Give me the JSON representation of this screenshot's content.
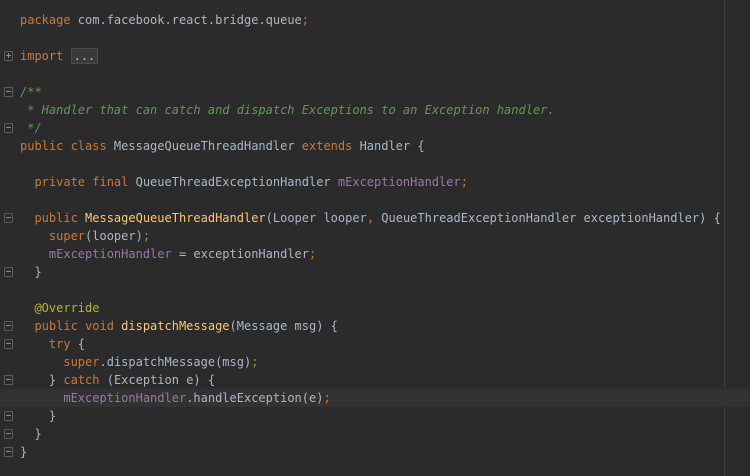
{
  "editor": {
    "lines": [
      {
        "tokens": [
          {
            "t": "package",
            "c": "kw"
          },
          {
            "t": " com.facebook.react.bridge.queue",
            "c": "pl"
          },
          {
            "t": ";",
            "c": "kw"
          }
        ]
      },
      {
        "tokens": []
      },
      {
        "fold": "plus",
        "tokens": [
          {
            "t": "import ",
            "c": "kw"
          },
          {
            "t": "...",
            "c": "collapsed"
          }
        ]
      },
      {
        "tokens": []
      },
      {
        "fold": "minus",
        "tokens": [
          {
            "t": "/**",
            "c": "cm"
          }
        ]
      },
      {
        "tokens": [
          {
            "t": " * Handler that can catch and dispatch Exceptions to an Exception handler.",
            "c": "cm"
          }
        ]
      },
      {
        "fold": "end",
        "tokens": [
          {
            "t": " */",
            "c": "cm"
          }
        ]
      },
      {
        "tokens": [
          {
            "t": "public class ",
            "c": "kw"
          },
          {
            "t": "MessageQueueThreadHandler ",
            "c": "pl"
          },
          {
            "t": "extends ",
            "c": "kw"
          },
          {
            "t": "Handler {",
            "c": "pl"
          }
        ]
      },
      {
        "tokens": []
      },
      {
        "tokens": [
          {
            "t": "  private final ",
            "c": "kw"
          },
          {
            "t": "QueueThreadExceptionHandler ",
            "c": "pl"
          },
          {
            "t": "mExceptionHandler",
            "c": "fld"
          },
          {
            "t": ";",
            "c": "kw"
          }
        ]
      },
      {
        "tokens": []
      },
      {
        "fold": "minus",
        "tokens": [
          {
            "t": "  public ",
            "c": "kw"
          },
          {
            "t": "MessageQueueThreadHandler",
            "c": "fn"
          },
          {
            "t": "(Looper looper",
            "c": "pl"
          },
          {
            "t": ", ",
            "c": "kw"
          },
          {
            "t": "QueueThreadExceptionHandler exceptionHandler) {",
            "c": "pl"
          }
        ]
      },
      {
        "tokens": [
          {
            "t": "    super",
            "c": "kw"
          },
          {
            "t": "(looper)",
            "c": "pl"
          },
          {
            "t": ";",
            "c": "kw"
          }
        ]
      },
      {
        "tokens": [
          {
            "t": "    ",
            "c": "pl"
          },
          {
            "t": "mExceptionHandler",
            "c": "fld"
          },
          {
            "t": " = exceptionHandler",
            "c": "pl"
          },
          {
            "t": ";",
            "c": "kw"
          }
        ]
      },
      {
        "fold": "end",
        "tokens": [
          {
            "t": "  }",
            "c": "pl"
          }
        ]
      },
      {
        "tokens": []
      },
      {
        "tokens": [
          {
            "t": "  @Override",
            "c": "an"
          }
        ]
      },
      {
        "fold": "minus",
        "tokens": [
          {
            "t": "  public void ",
            "c": "kw"
          },
          {
            "t": "dispatchMessage",
            "c": "fn"
          },
          {
            "t": "(Message msg) {",
            "c": "pl"
          }
        ]
      },
      {
        "fold": "minus",
        "tokens": [
          {
            "t": "    try ",
            "c": "kw"
          },
          {
            "t": "{",
            "c": "pl"
          }
        ]
      },
      {
        "tokens": [
          {
            "t": "      super",
            "c": "kw"
          },
          {
            "t": ".dispatchMessage(msg)",
            "c": "pl"
          },
          {
            "t": ";",
            "c": "kw"
          }
        ]
      },
      {
        "fold": "minus",
        "tokens": [
          {
            "t": "    } ",
            "c": "pl"
          },
          {
            "t": "catch ",
            "c": "kw"
          },
          {
            "t": "(Exception e) {",
            "c": "pl"
          }
        ]
      },
      {
        "current": true,
        "tokens": [
          {
            "t": "      ",
            "c": "pl"
          },
          {
            "t": "mExceptionHandler",
            "c": "fld"
          },
          {
            "t": ".handleException(e)",
            "c": "pl"
          },
          {
            "t": ";",
            "c": "kw"
          }
        ]
      },
      {
        "fold": "end",
        "tokens": [
          {
            "t": "    }",
            "c": "pl"
          }
        ]
      },
      {
        "fold": "end",
        "tokens": [
          {
            "t": "  }",
            "c": "pl"
          }
        ]
      },
      {
        "fold": "end",
        "tokens": [
          {
            "t": "}",
            "c": "pl"
          }
        ]
      }
    ]
  },
  "colors": {
    "background": "#2b2b2b",
    "keyword": "#cc7832",
    "plain": "#a9b7c6",
    "function": "#ffc66d",
    "field": "#9876aa",
    "comment": "#629755",
    "annotation": "#bbb529"
  }
}
